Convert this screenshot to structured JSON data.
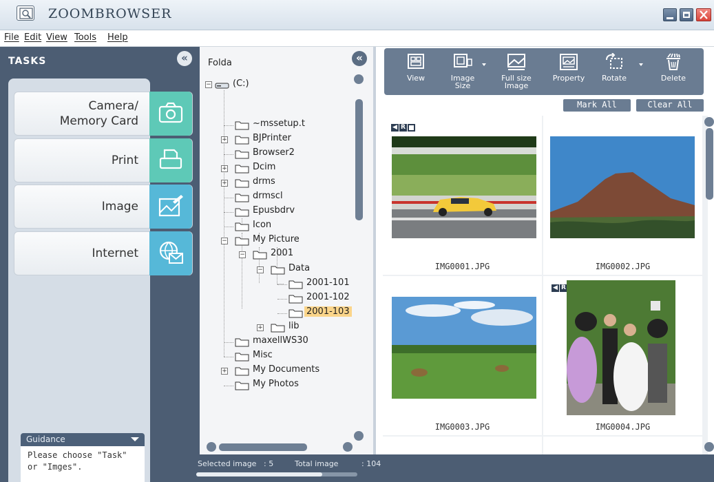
{
  "app": {
    "title": "ZOOMBROWSER"
  },
  "menu": [
    {
      "label": "File"
    },
    {
      "label": "Edit"
    },
    {
      "label": "View"
    },
    {
      "label": "Tools"
    },
    {
      "label": "Help"
    }
  ],
  "tasks": {
    "header": "TASKS",
    "collapse_glyph": "«",
    "items": [
      {
        "label": "Camera/\nMemory Card",
        "icon": "camera-icon",
        "color": "#5ec9b7"
      },
      {
        "label": "Print",
        "icon": "printer-icon",
        "color": "#5ec9b7"
      },
      {
        "label": "Image",
        "icon": "image-edit-icon",
        "color": "#56b8d8"
      },
      {
        "label": "Internet",
        "icon": "globe-mail-icon",
        "color": "#56b8d8"
      }
    ],
    "guidance": {
      "title": "Guidance",
      "text1": "Please choose \"Task\"",
      "text2": "or \"Imges\"."
    }
  },
  "tree": {
    "header": "Folda",
    "collapse_glyph": "«",
    "nodes": [
      {
        "name": "(C:)",
        "type": "drive",
        "expanded": true
      },
      {
        "name": "~mssetup.t"
      },
      {
        "name": "BJPrinter",
        "expander": "+"
      },
      {
        "name": "Browser2"
      },
      {
        "name": "Dcim",
        "expander": "+"
      },
      {
        "name": "drms",
        "expander": "+"
      },
      {
        "name": "drmscl"
      },
      {
        "name": "Epusbdrv"
      },
      {
        "name": "Icon"
      },
      {
        "name": "My Picture",
        "expander": "−"
      },
      {
        "name": "2001",
        "expander": "−"
      },
      {
        "name": "Data",
        "expander": "−"
      },
      {
        "name": "2001-101"
      },
      {
        "name": "2001-102"
      },
      {
        "name": "2001-103",
        "selected": true
      },
      {
        "name": "lib",
        "expander": "+"
      },
      {
        "name": "maxellWS30"
      },
      {
        "name": "Misc"
      },
      {
        "name": "My Documents",
        "expander": "+"
      },
      {
        "name": "My Photos"
      }
    ]
  },
  "toolbar": {
    "tools": [
      {
        "label1": "View",
        "label2": "",
        "icon": "view-icon"
      },
      {
        "label1": "Image",
        "label2": "Size",
        "icon": "image-size-icon"
      },
      {
        "label1": "Full size",
        "label2": "Image",
        "icon": "full-size-image-icon"
      },
      {
        "label1": "Property",
        "label2": "",
        "icon": "property-icon"
      },
      {
        "label1": "Rotate",
        "label2": "",
        "icon": "rotate-icon"
      },
      {
        "label1": "Delete",
        "label2": "",
        "icon": "trash-icon"
      }
    ],
    "mark_all": "Mark All",
    "clear_all": "Clear All"
  },
  "images": [
    {
      "file": "IMG0001.JPG",
      "badges": [
        "sound",
        "R",
        "movie"
      ],
      "subject": "race car on track"
    },
    {
      "file": "IMG0002.JPG",
      "badges": [],
      "subject": "mountain landscape"
    },
    {
      "file": "IMG0003.JPG",
      "badges": [],
      "subject": "meadow with hay bales"
    },
    {
      "file": "IMG0004.JPG",
      "badges": [
        "sound",
        "R"
      ],
      "subject": "wedding with costumed characters"
    }
  ],
  "status": {
    "selected_label": "Selected image",
    "selected_value": ": 5",
    "total_label": "Total image",
    "total_value": ": 104",
    "progress": 0.78
  },
  "colors": {
    "panel": "#4c5d73",
    "accent_teal": "#5ec9b7",
    "accent_blue": "#56b8d8",
    "selection": "#fbd58a"
  }
}
